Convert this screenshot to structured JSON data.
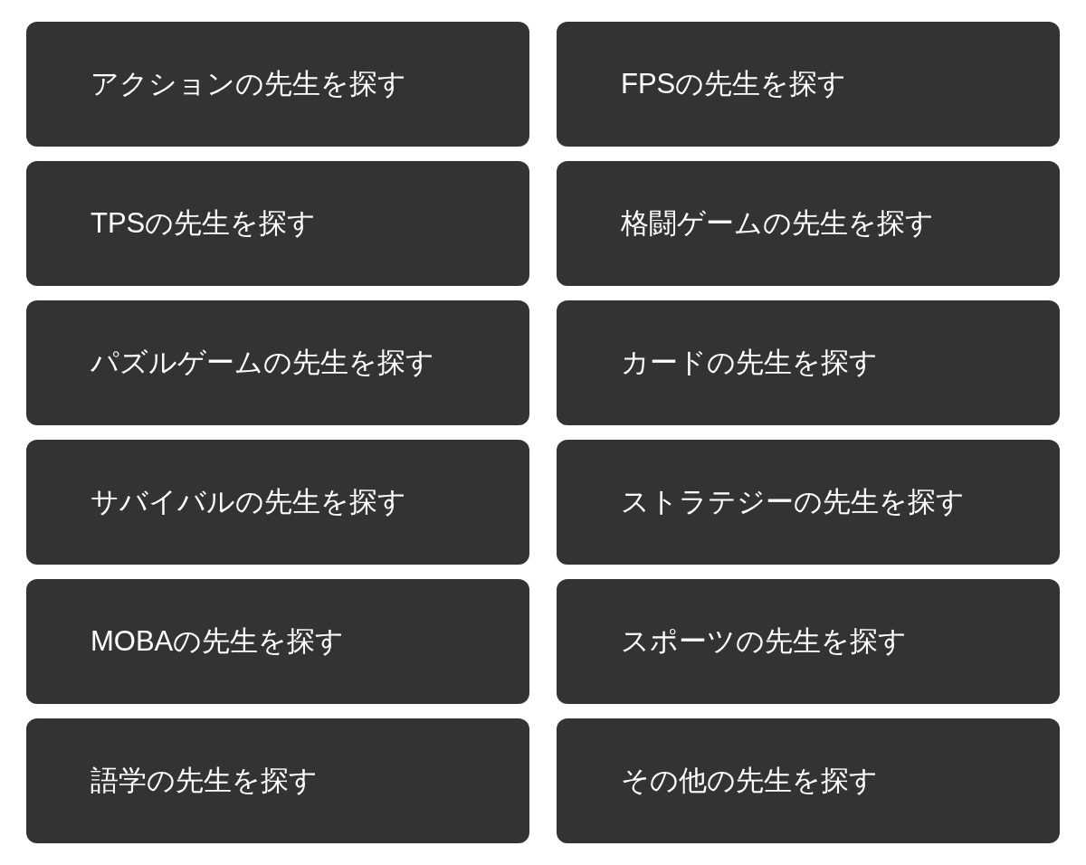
{
  "buttons": [
    "アクションの先生を探す",
    "FPSの先生を探す",
    "TPSの先生を探す",
    "格闘ゲームの先生を探す",
    "パズルゲームの先生を探す",
    "カードの先生を探す",
    "サバイバルの先生を探す",
    "ストラテジーの先生を探す",
    "MOBAの先生を探す",
    "スポーツの先生を探す",
    "語学の先生を探す",
    "その他の先生を探す"
  ]
}
